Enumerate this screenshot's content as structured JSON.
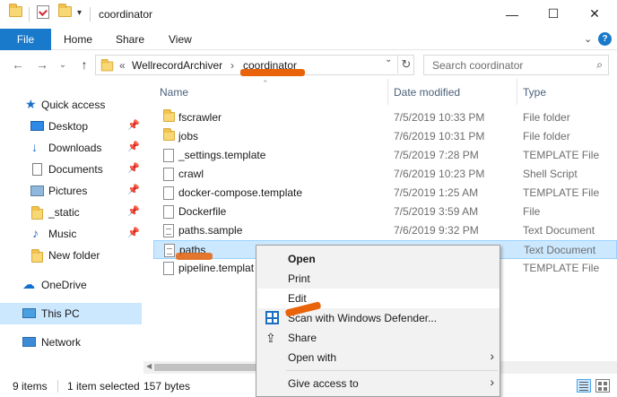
{
  "window": {
    "title": "coordinator",
    "minimize": "—",
    "maximize": "☐",
    "close": "✕"
  },
  "ribbon": {
    "file": "File",
    "tabs": [
      "Home",
      "Share",
      "View"
    ],
    "expand": "⌄",
    "help": "?"
  },
  "nav": {
    "back": "←",
    "forward": "→",
    "recent": "⌄",
    "up": "↑",
    "breadcrumb_prefix": "«",
    "breadcrumbs": [
      "WellrecordArchiver",
      "coordinator"
    ],
    "crumb_separator": "›",
    "dropdown": "⌄",
    "refresh": "↻",
    "search_placeholder": "Search coordinator",
    "search_icon": "⌕"
  },
  "sidebar": {
    "items": [
      {
        "label": "Quick access",
        "icon": "star-icon",
        "pinned": false
      },
      {
        "label": "Desktop",
        "icon": "desktop-icon",
        "pinned": true
      },
      {
        "label": "Downloads",
        "icon": "download-icon",
        "pinned": true
      },
      {
        "label": "Documents",
        "icon": "documents-icon",
        "pinned": true
      },
      {
        "label": "Pictures",
        "icon": "pictures-icon",
        "pinned": true
      },
      {
        "label": "_static",
        "icon": "folder-icon",
        "pinned": true
      },
      {
        "label": "Music",
        "icon": "music-icon",
        "pinned": true
      },
      {
        "label": "New folder",
        "icon": "folder-icon",
        "pinned": false
      },
      {
        "label": "OneDrive",
        "icon": "cloud-icon",
        "pinned": false
      },
      {
        "label": "This PC",
        "icon": "computer-icon",
        "pinned": false,
        "selected": true
      },
      {
        "label": "Network",
        "icon": "network-icon",
        "pinned": false
      }
    ],
    "pin_glyph": "📌"
  },
  "columns": {
    "name": "Name",
    "date": "Date modified",
    "type": "Type"
  },
  "files": [
    {
      "name": "fscrawler",
      "date": "7/5/2019 10:33 PM",
      "type": "File folder",
      "icon": "folder-icon"
    },
    {
      "name": "jobs",
      "date": "7/6/2019 10:31 PM",
      "type": "File folder",
      "icon": "folder-icon"
    },
    {
      "name": "_settings.template",
      "date": "7/5/2019 7:28 PM",
      "type": "TEMPLATE File",
      "icon": "file-icon"
    },
    {
      "name": "crawl",
      "date": "7/6/2019 10:23 PM",
      "type": "Shell Script",
      "icon": "file-icon"
    },
    {
      "name": "docker-compose.template",
      "date": "7/5/2019 1:25 AM",
      "type": "TEMPLATE File",
      "icon": "file-icon"
    },
    {
      "name": "Dockerfile",
      "date": "7/5/2019 3:59 AM",
      "type": "File",
      "icon": "file-icon"
    },
    {
      "name": "paths.sample",
      "date": "7/6/2019 9:32 PM",
      "type": "Text Document",
      "icon": "text-file-icon"
    },
    {
      "name": "paths",
      "date": "",
      "type": "Text Document",
      "icon": "text-file-icon",
      "selected": true
    },
    {
      "name": "pipeline.templat",
      "date": "",
      "type": "TEMPLATE File",
      "icon": "file-icon"
    }
  ],
  "status": {
    "item_count": "9 items",
    "selection": "1 item selected",
    "size": "157 bytes"
  },
  "context_menu": {
    "items": [
      {
        "label": "Open",
        "bold": true
      },
      {
        "label": "Print"
      },
      {
        "label": "Edit",
        "hover": true
      },
      {
        "label": "Scan with Windows Defender...",
        "icon": "windows-defender-icon"
      },
      {
        "label": "Share",
        "icon": "share-icon"
      },
      {
        "label": "Open with",
        "submenu": true
      },
      {
        "label": "Give access to",
        "submenu": true
      }
    ],
    "submenu_arrow": "›",
    "share_glyph": "⇪"
  },
  "annotation_color": "#e8630a"
}
